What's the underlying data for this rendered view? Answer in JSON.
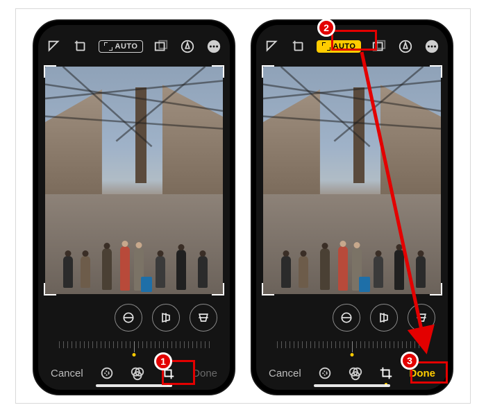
{
  "left_screen": {
    "topbar": {
      "auto_label": "AUTO",
      "auto_active": false
    },
    "round_buttons": [
      "straighten",
      "flip-horizontal",
      "flip-vertical"
    ],
    "bottombar": {
      "cancel": "Cancel",
      "done": "Done",
      "done_active": false,
      "tabs": [
        "adjust",
        "filters",
        "crop"
      ],
      "active_tab": "crop"
    }
  },
  "right_screen": {
    "topbar": {
      "auto_label": "AUTO",
      "auto_active": true
    },
    "round_buttons": [
      "straighten",
      "flip-horizontal",
      "flip-vertical"
    ],
    "bottombar": {
      "cancel": "Cancel",
      "done": "Done",
      "done_active": true,
      "tabs": [
        "adjust",
        "filters",
        "crop"
      ],
      "active_tab": "crop"
    }
  },
  "annotations": {
    "steps": [
      "1",
      "2",
      "3"
    ],
    "color": "#e30000"
  }
}
